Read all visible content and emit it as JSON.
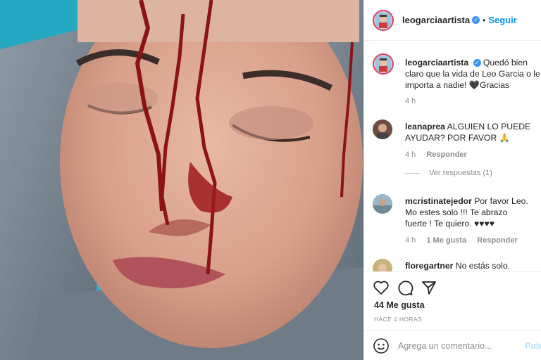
{
  "post_header": {
    "username": "leogarciaartista",
    "separator": "•",
    "follow_label": "Seguir"
  },
  "caption": {
    "username": "leogarciaartista",
    "text": "Quedó bien claro que la vida de Leo Garcia o le importa a nadie! 🖤Gracias",
    "time": "4 h"
  },
  "comments": [
    {
      "username": "leanaprea",
      "text": "ALGUIEN LO PUEDE AYUDAR? POR FAVOR 🙏",
      "time": "4 h",
      "reply": "Responder",
      "view_replies": "Ver respuestas (1)"
    },
    {
      "username": "mcristinatejedor",
      "text": "Por favor Leo. Mo estes solo !!! Te abrazo fuerte ! Te quiero. ♥♥♥♥",
      "time": "4 h",
      "likes": "1 Me gusta",
      "reply": "Responder"
    },
    {
      "username": "floregartner",
      "text": "No estás solo."
    }
  ],
  "actions": {
    "likes": "44 Me gusta",
    "posted": "HACE 4 HORAS"
  },
  "add_comment": {
    "placeholder": "Agrega un comentario...",
    "publish": "Publicar"
  },
  "colors": {
    "link": "#0095f6",
    "verified": "#3897f0",
    "story_ring": "#e3415b"
  },
  "icons": [
    "heart-icon",
    "comment-icon",
    "share-icon",
    "emoji-icon",
    "verified-icon"
  ]
}
